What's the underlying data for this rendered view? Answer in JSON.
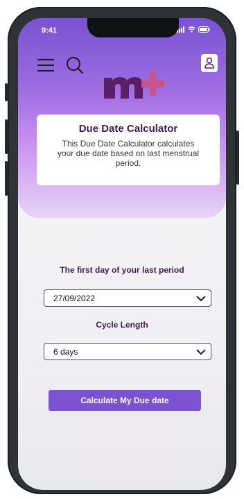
{
  "status_bar": {
    "time": "9:41"
  },
  "header": {
    "menu_icon": "hamburger-menu-icon",
    "search_icon": "search-icon",
    "profile_icon": "user-profile-icon",
    "logo_text": "m+"
  },
  "info_card": {
    "title": "Due Date Calculator",
    "description": "This Due Date Calculator calculates your due date based on last menstrual period."
  },
  "form": {
    "period_label": "The first day of your last period",
    "period_value": "27/09/2022",
    "cycle_label": "Cycle Length",
    "cycle_value": "6 days",
    "submit_label": "Calculate My Due date"
  },
  "colors": {
    "accent": "#7a52d3",
    "logo": "#5b1f66",
    "heading": "#3d1b52"
  }
}
